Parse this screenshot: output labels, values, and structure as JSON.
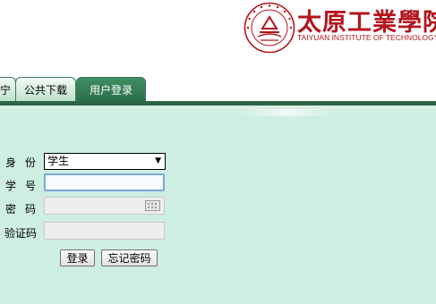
{
  "header": {
    "school_name": "太原工業學院",
    "school_name_en": "TAIYUAN INSTITUTE OF TECHNOLOGY",
    "brand_color": "#b3151e"
  },
  "tabs": [
    {
      "label": "宁",
      "active": false
    },
    {
      "label": "公共下载",
      "active": false
    },
    {
      "label": "用户登录",
      "active": true
    }
  ],
  "form": {
    "identity_label": "身份",
    "identity_value": "学生",
    "student_id_label": "学号",
    "student_id_value": "",
    "password_label": "密码",
    "password_value": "",
    "captcha_label": "验证码",
    "captcha_value": ""
  },
  "buttons": {
    "login": "登录",
    "forgot_password": "忘记密码"
  }
}
